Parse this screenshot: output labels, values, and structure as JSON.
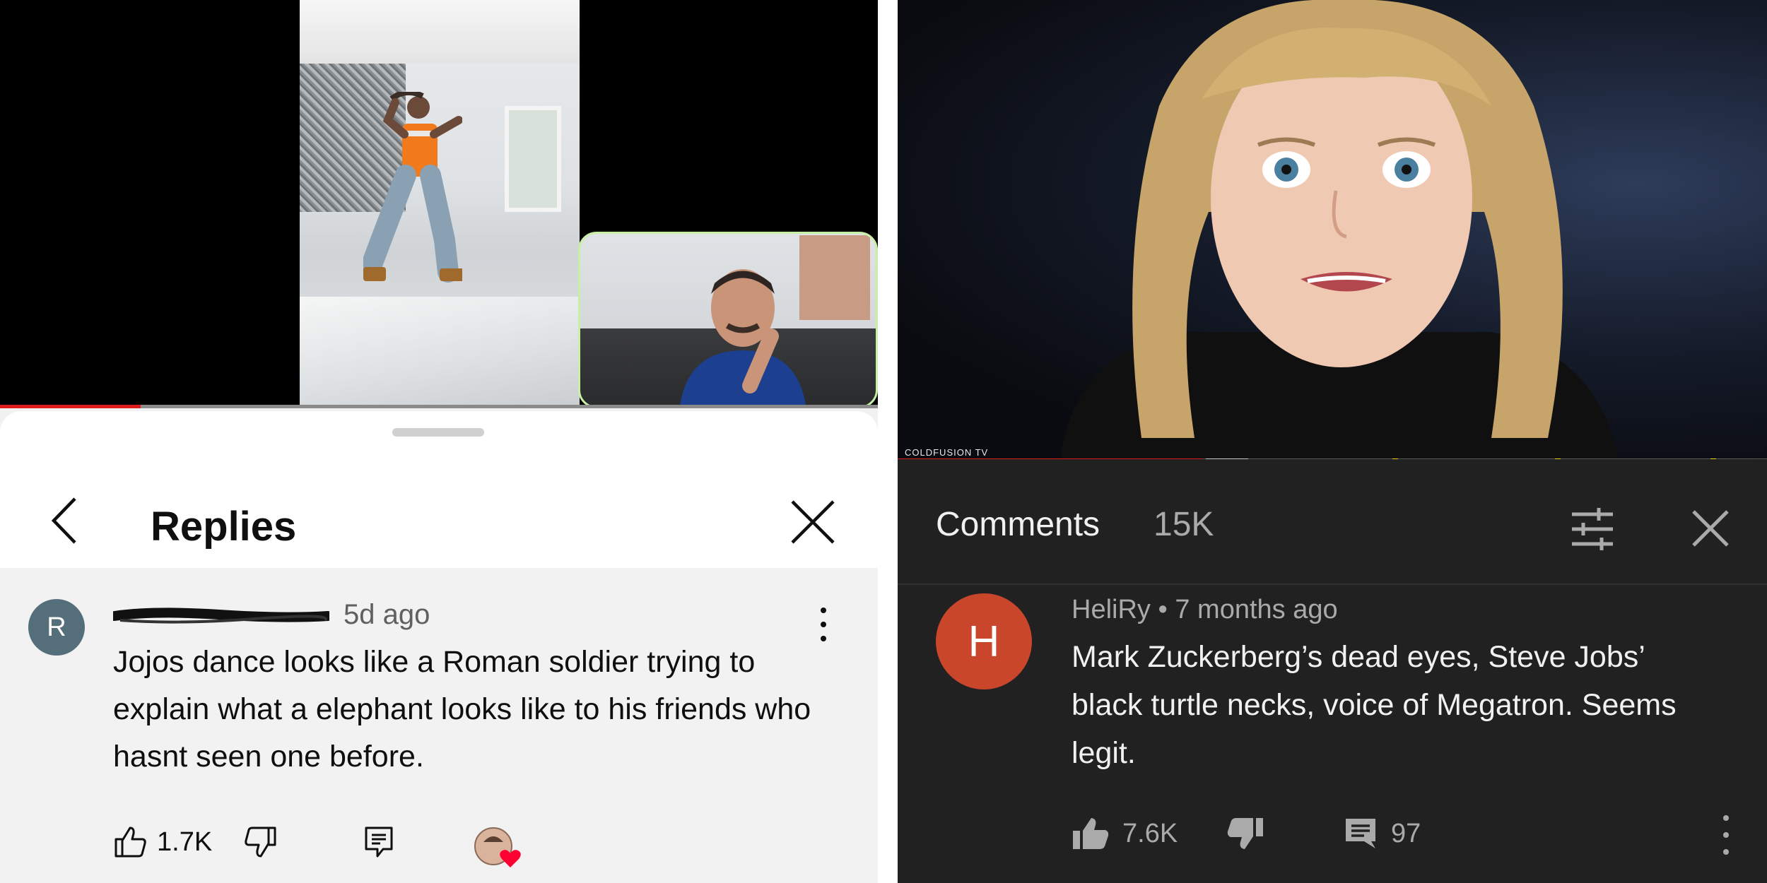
{
  "left_panel": {
    "sheet_title": "Replies",
    "comment": {
      "avatar_letter": "R",
      "time_ago": "5d ago",
      "text": "Jojos dance looks like a Roman soldier trying to explain what a elephant looks like to his friends who hasnt seen one before.",
      "like_count": "1.7K"
    },
    "progress_fraction": 0.16
  },
  "right_panel": {
    "watermark": "COLDFUSION TV",
    "header_title": "Comments",
    "comment_count": "15K",
    "comment": {
      "avatar_letter": "H",
      "author": "HeliRy",
      "separator": "•",
      "time_ago": "7 months ago",
      "text": "Mark Zuckerberg’s dead eyes, Steve Jobs’ black turtle necks, voice of Megatron. Seems legit.",
      "like_count": "7.6K",
      "reply_count": "97"
    },
    "progress_fraction": 0.35
  },
  "colors": {
    "progress_red": "#e01b1b",
    "left_avatar": "#546e7a",
    "right_avatar": "#c9462b",
    "dark_bg": "#212121",
    "heart": "#ff0033"
  },
  "icons": [
    "chevron-left-icon",
    "close-icon",
    "kebab-menu-icon",
    "thumb-up-icon",
    "thumb-down-icon",
    "reply-icon",
    "creator-heart-icon",
    "filter-icon",
    "comment-icon"
  ]
}
